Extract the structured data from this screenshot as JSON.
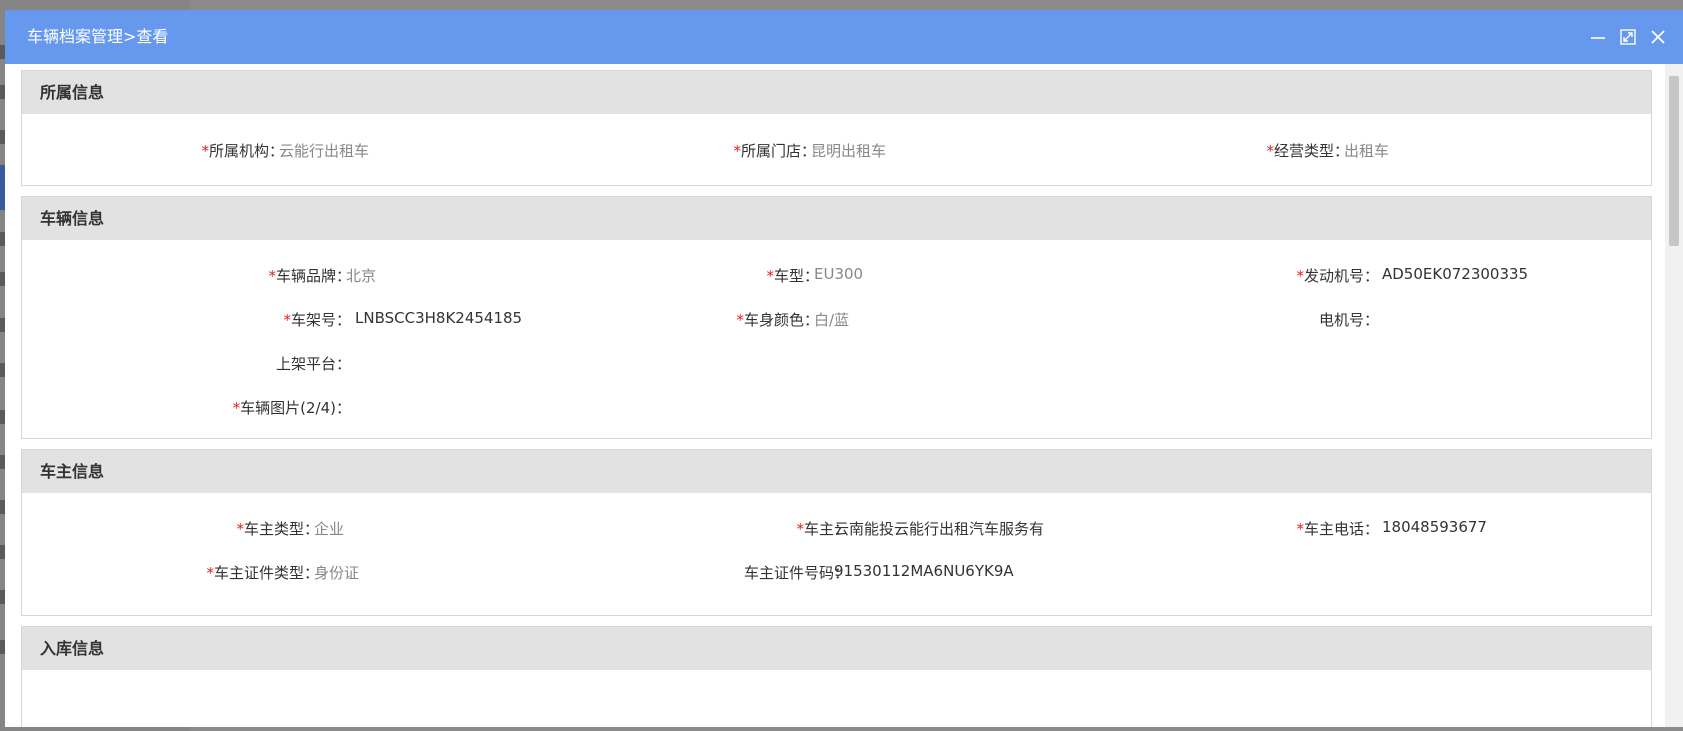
{
  "window": {
    "title": "车辆档案管理>查看"
  },
  "sections": {
    "belong": {
      "title": "所属信息",
      "org_label": "所属机构：",
      "org_value": "云能行出租车",
      "store_label": "所属门店：",
      "store_value": "昆明出租车",
      "biz_label": "经营类型：",
      "biz_value": "出租车"
    },
    "vehicle": {
      "title": "车辆信息",
      "brand_label": "车辆品牌：",
      "brand_value": "北京",
      "model_label": "车型：",
      "model_value": "EU300",
      "engine_label": "发动机号：",
      "engine_value": "AD50EK072300335",
      "vin_label": "车架号：",
      "vin_value": "LNBSCC3H8K2454185",
      "color_label": "车身颜色：",
      "color_value": "白/蓝",
      "motor_label": "电机号：",
      "motor_value": "",
      "platform_label": "上架平台：",
      "platform_value": "",
      "photo_label": "车辆图片(2/4)：",
      "photo_value": ""
    },
    "owner": {
      "title": "车主信息",
      "type_label": "车主类型：",
      "type_value": "企业",
      "owner_label": "车主：",
      "owner_value": "云南能投云能行出租汽车服务有",
      "phone_label": "车主电话：",
      "phone_value": "18048593677",
      "idtype_label": "车主证件类型：",
      "idtype_value": "身份证",
      "idno_label": "车主证件号码：",
      "idno_value": "91530112MA6NU6YK9A"
    },
    "storage": {
      "title": "入库信息"
    }
  },
  "required_mark": "*",
  "colors": {
    "titlebar": "#6699ee",
    "required": "#e02020",
    "section_header": "#e2e2e2"
  },
  "icons": {
    "minimize": "minimize-icon",
    "maximize": "maximize-icon",
    "close": "close-icon"
  }
}
